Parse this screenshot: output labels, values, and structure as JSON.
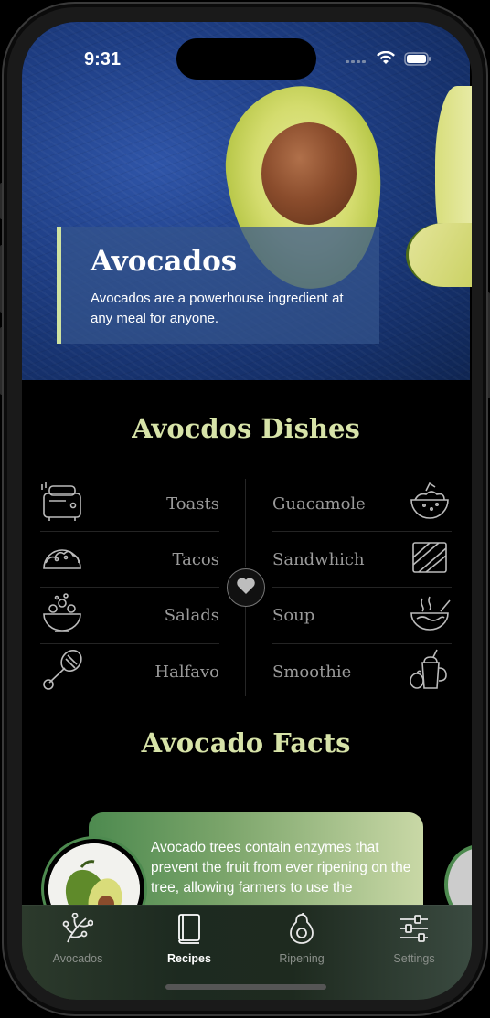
{
  "status": {
    "time": "9:31"
  },
  "hero": {
    "title": "Avocados",
    "description": "Avocados are a powerhouse ingredient at any meal for anyone."
  },
  "dishes": {
    "title": "Avocdos Dishes",
    "left": [
      {
        "label": "Toasts",
        "icon": "toaster-icon"
      },
      {
        "label": "Tacos",
        "icon": "taco-icon"
      },
      {
        "label": "Salads",
        "icon": "salad-bowl-icon"
      },
      {
        "label": "Halfavo",
        "icon": "halfavo-icon"
      }
    ],
    "right": [
      {
        "label": "Guacamole",
        "icon": "guacamole-bowl-icon"
      },
      {
        "label": "Sandwhich",
        "icon": "sandwich-icon"
      },
      {
        "label": "Soup",
        "icon": "soup-bowl-icon"
      },
      {
        "label": "Smoothie",
        "icon": "smoothie-icon"
      }
    ]
  },
  "facts": {
    "title": "Avocado Facts",
    "text": "Avocado trees contain enzymes that prevent the fruit from ever ripening on the tree, allowing farmers to use the"
  },
  "tabbar": {
    "tabs": [
      {
        "label": "Avocados",
        "icon": "avocado-branch-icon",
        "active": false
      },
      {
        "label": "Recipes",
        "icon": "book-icon",
        "active": true
      },
      {
        "label": "Ripening",
        "icon": "avocado-icon",
        "active": false
      },
      {
        "label": "Settings",
        "icon": "sliders-icon",
        "active": false
      }
    ]
  },
  "colors": {
    "accent": "#d7e3a8",
    "hero_blue": "#1f3f86",
    "fact_green": "#4d8a4f"
  }
}
